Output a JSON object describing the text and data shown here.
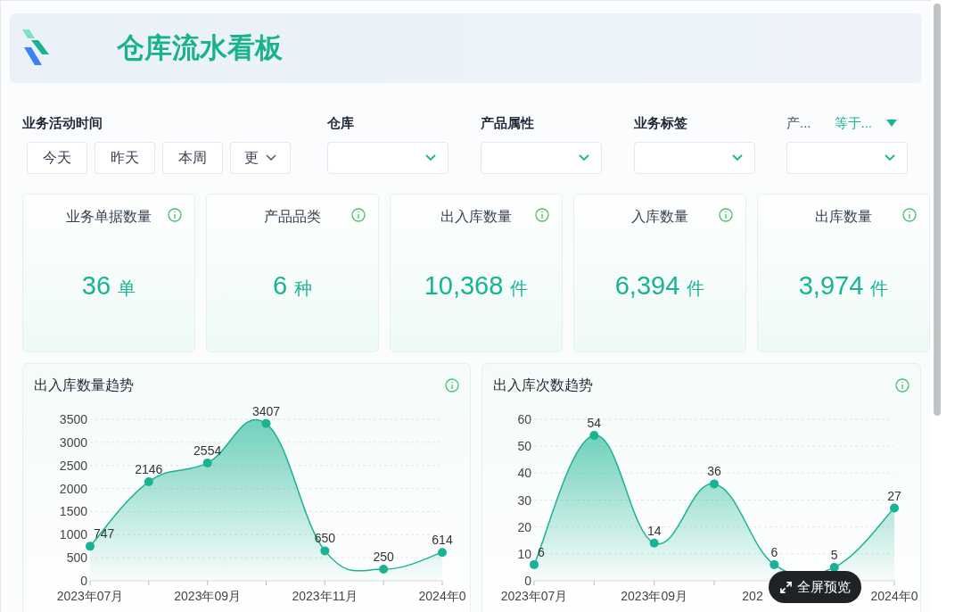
{
  "header": {
    "title": "仓库流水看板"
  },
  "filters": [
    {
      "kind": "time",
      "label": "业务活动时间",
      "options": [
        {
          "label": "今天",
          "selected": false
        },
        {
          "label": "昨天",
          "selected": false
        },
        {
          "label": "本周",
          "selected": false
        }
      ],
      "more": "更"
    },
    {
      "kind": "select",
      "label": "仓库"
    },
    {
      "kind": "select",
      "label": "产品属性"
    },
    {
      "kind": "select",
      "label": "业务标签"
    },
    {
      "kind": "condition",
      "label": "产...",
      "operator": "等于..."
    }
  ],
  "kpis": [
    {
      "title": "业务单据数量",
      "value": "36",
      "unit": "单"
    },
    {
      "title": "产品品类",
      "value": "6",
      "unit": "种"
    },
    {
      "title": "出入库数量",
      "value": "10,368",
      "unit": "件"
    },
    {
      "title": "入库数量",
      "value": "6,394",
      "unit": "件"
    },
    {
      "title": "出库数量",
      "value": "3,974",
      "unit": "件"
    }
  ],
  "charts": [
    {
      "title": "出入库数量趋势",
      "chart_data": {
        "type": "area",
        "categories": [
          "2023年07月",
          null,
          "2023年09月",
          null,
          "2023年11月",
          null,
          "2024年0"
        ],
        "series": [
          {
            "color": "#19b394",
            "values": [
              747,
              2146,
              2554,
              3407,
              650,
              250,
              614
            ]
          }
        ],
        "ylim": [
          0,
          3500
        ],
        "yticks": [
          0,
          500,
          1000,
          1500,
          2000,
          2500,
          3000,
          3500
        ],
        "grid": true,
        "data_labels": true
      }
    },
    {
      "title": "出入库次数趋势",
      "chart_data": {
        "type": "area",
        "categories": [
          "2023年07月",
          null,
          "2023年09月",
          null,
          null,
          null,
          "2024年0"
        ],
        "series": [
          {
            "color": "#19b394",
            "values": [
              6,
              54,
              14,
              36,
              6,
              5,
              27
            ]
          }
        ],
        "ylim": [
          0,
          60
        ],
        "yticks": [
          0,
          10,
          20,
          30,
          40,
          50,
          60
        ],
        "grid": true,
        "data_labels": true,
        "annotations": [
          "202"
        ]
      }
    }
  ],
  "fullscreen_button": "全屏预览"
}
